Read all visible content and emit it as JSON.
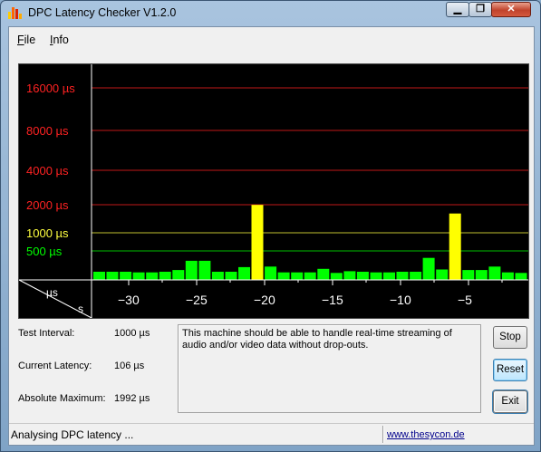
{
  "window": {
    "title": "DPC Latency Checker V1.2.0",
    "controls": {
      "minimize": "▁",
      "maximize": "❐",
      "close": "✕"
    }
  },
  "menu": [
    {
      "mnemonic": "F",
      "rest": "ile"
    },
    {
      "mnemonic": "I",
      "rest": "nfo"
    }
  ],
  "chart_data": {
    "type": "bar",
    "ylabels": [
      {
        "text": "16000 µs",
        "color": "#ff2222"
      },
      {
        "text": "8000 µs",
        "color": "#ff2222"
      },
      {
        "text": "4000 µs",
        "color": "#ff2222"
      },
      {
        "text": "2000 µs",
        "color": "#ff2222"
      },
      {
        "text": "1000 µs",
        "color": "#ffff40"
      },
      {
        "text": "500 µs",
        "color": "#00ff00"
      }
    ],
    "corner": {
      "top": "µs",
      "bottom": "s"
    },
    "xticks": [
      "−30",
      "−25",
      "−20",
      "−15",
      "−10",
      "−5"
    ],
    "values_us": [
      140,
      140,
      140,
      130,
      130,
      140,
      170,
      330,
      330,
      140,
      140,
      220,
      1992,
      230,
      130,
      130,
      130,
      190,
      120,
      150,
      140,
      130,
      130,
      140,
      140,
      380,
      180,
      1610,
      170,
      170,
      230,
      130,
      120
    ],
    "bar_colors": {
      "normal": "#00ff00",
      "warning": "#ffff00"
    }
  },
  "stats": {
    "test_interval_label": "Test Interval:",
    "test_interval_value": "1000 µs",
    "current_latency_label": "Current Latency:",
    "current_latency_value": "106 µs",
    "absolute_maximum_label": "Absolute Maximum:",
    "absolute_maximum_value": "1992 µs"
  },
  "message": "This machine should be able to handle real-time streaming of audio and/or video data without drop-outs.",
  "buttons": {
    "stop": "Stop",
    "reset": "Reset",
    "exit": "Exit"
  },
  "status": {
    "text": "Analysing DPC latency ...",
    "link": "www.thesycon.de"
  }
}
